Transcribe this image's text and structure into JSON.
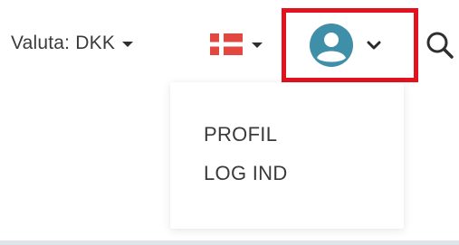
{
  "header": {
    "currency": {
      "label": "Valuta: DKK",
      "icon": "caret-down-icon"
    },
    "language": {
      "flag": "denmark-flag-icon",
      "flag_colors": {
        "red": "#e4473f",
        "white": "#ffffff"
      },
      "icon": "caret-down-icon"
    },
    "user_menu": {
      "avatar_icon": "user-avatar-icon",
      "avatar_color": "#3f8fa8",
      "dropdown_icon": "chevron-down-icon",
      "highlight_color": "#e3121f"
    },
    "search": {
      "icon": "search-icon"
    }
  },
  "dropdown": {
    "items": [
      {
        "label": "PROFIL"
      },
      {
        "label": "LOG IND"
      }
    ]
  }
}
